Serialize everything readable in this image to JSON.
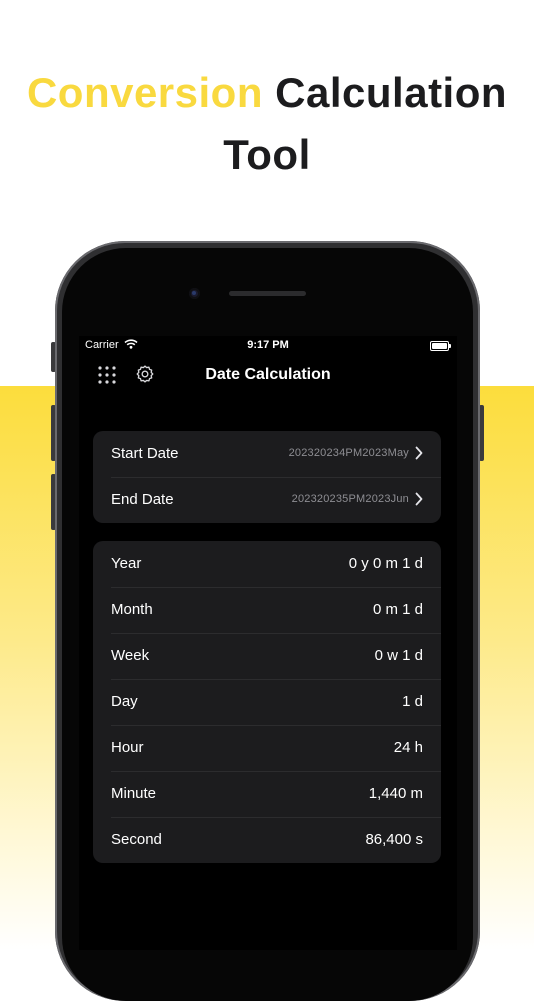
{
  "headline": {
    "accent": "Conversion",
    "rest_line1": "Calculation",
    "line2": "Tool"
  },
  "colors": {
    "accent_yellow": "#F9D93F",
    "card_bg": "#1c1c1e",
    "screen_bg": "#000000",
    "secondary_text": "#8e8e93"
  },
  "status_bar": {
    "carrier": "Carrier",
    "time": "9:17 PM"
  },
  "nav": {
    "title": "Date Calculation",
    "left_icon": "grid-icon",
    "settings_icon": "gear-icon"
  },
  "dates": {
    "start_label": "Start Date",
    "start_value": "202320234PM2023May",
    "end_label": "End Date",
    "end_value": "202320235PM2023Jun"
  },
  "results": [
    {
      "label": "Year",
      "value": "0 y 0 m 1 d"
    },
    {
      "label": "Month",
      "value": "0 m 1 d"
    },
    {
      "label": "Week",
      "value": "0 w 1 d"
    },
    {
      "label": "Day",
      "value": "1 d"
    },
    {
      "label": "Hour",
      "value": "24 h"
    },
    {
      "label": "Minute",
      "value": "1,440 m"
    },
    {
      "label": "Second",
      "value": "86,400 s"
    }
  ]
}
